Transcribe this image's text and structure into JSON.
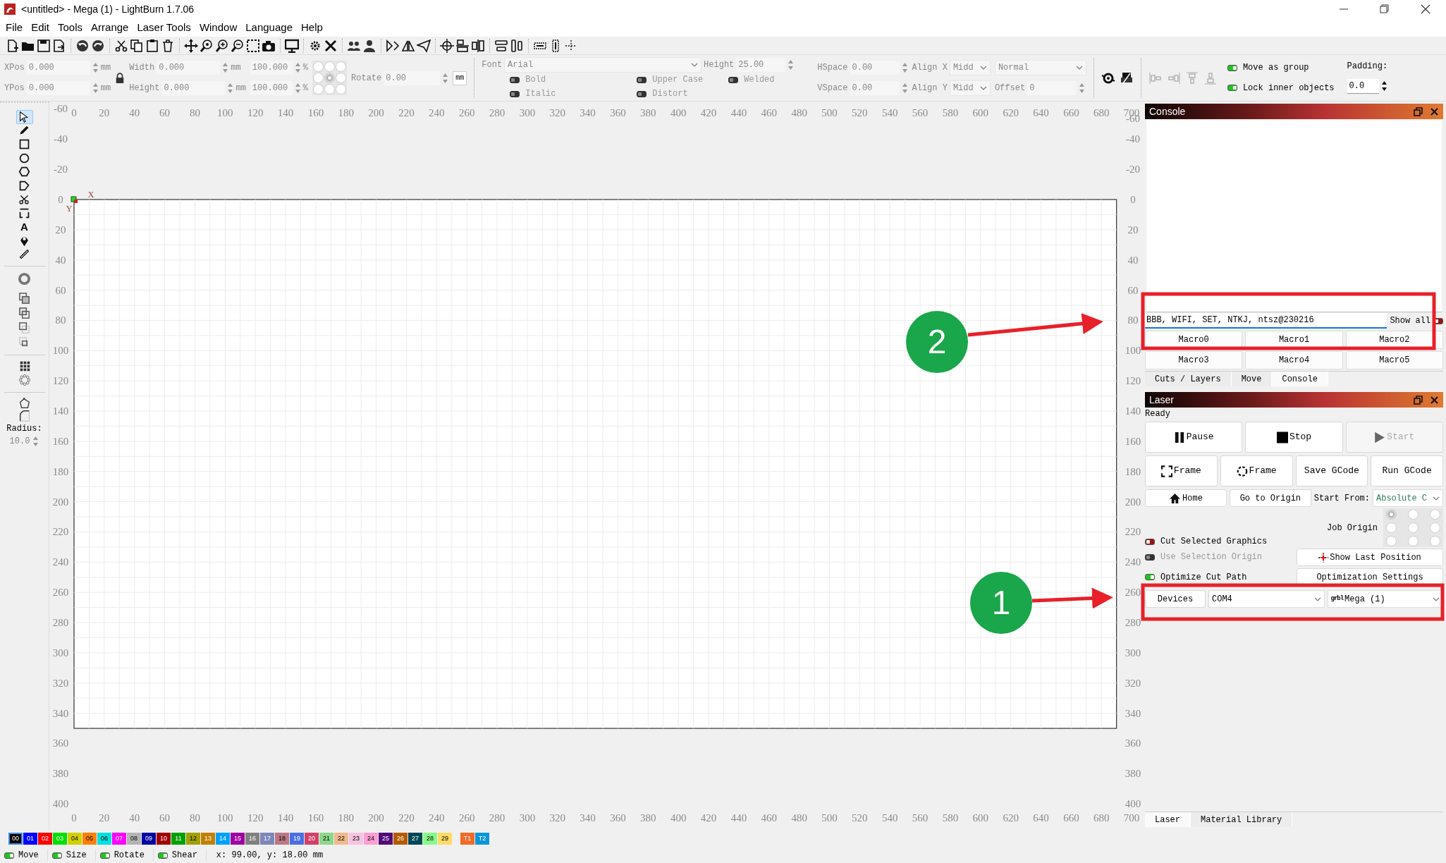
{
  "window": {
    "title": "<untitled> - Mega (1) - LightBurn 1.7.06"
  },
  "menu": [
    "File",
    "Edit",
    "Tools",
    "Arrange",
    "Laser Tools",
    "Window",
    "Language",
    "Help"
  ],
  "properties": {
    "position": [
      {
        "label": "XPos",
        "value": "0.000",
        "unit": "mm"
      },
      {
        "label": "YPos",
        "value": "0.000",
        "unit": "mm"
      }
    ],
    "size": [
      {
        "label": "Width",
        "value": "0.000",
        "unit": "mm"
      },
      {
        "label": "Height",
        "value": "0.000",
        "unit": "mm"
      }
    ],
    "scale": [
      {
        "value": "100.000",
        "unit": "%"
      },
      {
        "value": "100.000",
        "unit": "%"
      }
    ],
    "origin_grid": [
      {
        "selected": false
      },
      {
        "selected": false
      },
      {
        "selected": false
      },
      {
        "selected": false
      },
      {
        "selected": true
      },
      {
        "selected": false
      },
      {
        "selected": false
      },
      {
        "selected": false
      },
      {
        "selected": false
      }
    ],
    "rotate": {
      "label": "Rotate",
      "value": "0.00"
    },
    "unit_button": "mm",
    "font": {
      "label": "Font",
      "value": "Arial"
    },
    "font_height": {
      "label": "Height",
      "value": "25.00"
    },
    "text_toggles": [
      {
        "label": "Bold",
        "on": false,
        "disabled": true
      },
      {
        "label": "Italic",
        "on": false,
        "disabled": true
      },
      {
        "label": "Upper Case",
        "on": false,
        "disabled": true
      },
      {
        "label": "Distort",
        "on": false,
        "disabled": true
      },
      {
        "label": "Welded",
        "on": false,
        "disabled": true
      }
    ],
    "spacing": [
      {
        "label": "HSpace",
        "value": "0.00"
      },
      {
        "label": "VSpace",
        "value": "0.00"
      }
    ],
    "align": [
      {
        "label": "Align X",
        "value": "Midd"
      },
      {
        "label": "Align Y",
        "value": "Midd"
      }
    ],
    "text_mode": {
      "value": "Normal"
    },
    "offset": {
      "label": "Offset",
      "value": "0"
    },
    "group_toggles": [
      {
        "label": "Move as group",
        "on": true
      },
      {
        "label": "Lock inner objects",
        "on": true
      }
    ],
    "padding": {
      "label": "Padding:",
      "value": "0.0"
    }
  },
  "tools": [
    {
      "kind": "pointer",
      "selected": true
    },
    {
      "kind": "pencil",
      "selected": false
    },
    {
      "kind": "rectangle",
      "selected": false
    },
    {
      "kind": "ellipse",
      "selected": false
    },
    {
      "kind": "hexagon",
      "selected": false
    },
    {
      "kind": "pentagon",
      "selected": false
    },
    {
      "kind": "scissors",
      "selected": false
    },
    {
      "kind": "bracket",
      "selected": false
    },
    {
      "kind": "text",
      "glyph": "A",
      "selected": false
    },
    {
      "kind": "pin",
      "selected": false
    },
    {
      "kind": "ruler",
      "selected": false
    }
  ],
  "radius": {
    "label": "Radius:",
    "value": "10.0"
  },
  "canvas": {
    "top_ruler": [
      "0",
      "20",
      "40",
      "60",
      "80",
      "100",
      "120",
      "140",
      "160",
      "180",
      "200",
      "220",
      "240",
      "260",
      "280",
      "300",
      "320",
      "340",
      "360",
      "380",
      "400",
      "420",
      "440",
      "460",
      "480",
      "500",
      "520",
      "540",
      "560",
      "580",
      "600",
      "620",
      "640",
      "660",
      "680",
      "700"
    ],
    "left_ruler": [
      "-60",
      "-40",
      "-20",
      "0",
      "20",
      "40",
      "60",
      "80",
      "100",
      "120",
      "140",
      "160",
      "180",
      "200",
      "220",
      "240",
      "260",
      "280",
      "300",
      "320",
      "340",
      "360",
      "380",
      "400"
    ],
    "right_ruler": [
      "-60",
      "-40",
      "-20",
      "0",
      "20",
      "40",
      "60",
      "80",
      "100",
      "120",
      "140",
      "160",
      "180",
      "200",
      "220",
      "240",
      "260",
      "280",
      "300",
      "320",
      "340",
      "360",
      "380",
      "400"
    ],
    "bottom_ruler": [
      "0",
      "20",
      "40",
      "60",
      "80",
      "100",
      "120",
      "140",
      "160",
      "180",
      "200",
      "220",
      "240",
      "260",
      "280",
      "300",
      "320",
      "340",
      "360",
      "380",
      "400",
      "420",
      "440",
      "460",
      "480",
      "500",
      "520",
      "540",
      "560",
      "580",
      "600",
      "620",
      "640",
      "660",
      "680",
      "700"
    ],
    "axis_labels": [
      "X",
      "Y"
    ]
  },
  "console": {
    "title": "Console",
    "input": "BBB, WIFI, SET, NTKJ, ntsz@230216",
    "show_all": {
      "label": "Show all",
      "on": false
    },
    "macros": [
      "Macro0",
      "Macro1",
      "Macro2",
      "Macro3",
      "Macro4",
      "Macro5"
    ],
    "tabs": [
      {
        "label": "Cuts / Layers",
        "selected": false
      },
      {
        "label": "Move",
        "selected": false
      },
      {
        "label": "Console",
        "selected": true
      }
    ]
  },
  "laser": {
    "title": "Laser",
    "status": "Ready",
    "run_buttons": [
      {
        "kind": "pause",
        "label": "Pause",
        "disabled": false
      },
      {
        "kind": "stop",
        "label": "Stop",
        "disabled": false
      },
      {
        "kind": "start",
        "label": "Start",
        "disabled": true
      }
    ],
    "job_buttons": [
      {
        "kind": "frame-rect",
        "label": "Frame"
      },
      {
        "kind": "frame-circle",
        "label": "Frame"
      },
      {
        "kind": "plain",
        "label": "Save GCode"
      },
      {
        "kind": "plain",
        "label": "Run GCode"
      }
    ],
    "home": "Home",
    "go_to_origin": "Go to Origin",
    "start_from": {
      "label": "Start From:",
      "value": "Absolute C"
    },
    "job_origin": {
      "label": "Job Origin",
      "grid": [
        {
          "selected": true
        },
        {
          "selected": false
        },
        {
          "selected": false
        },
        {
          "selected": false
        },
        {
          "selected": false
        },
        {
          "selected": false
        },
        {
          "selected": false
        },
        {
          "selected": false
        },
        {
          "selected": false
        }
      ]
    },
    "toggles": [
      {
        "label": "Cut Selected Graphics",
        "on": false,
        "disabled": false
      },
      {
        "label": "Use Selection Origin",
        "on": false,
        "disabled": true
      },
      {
        "label": "Optimize Cut Path",
        "on": true,
        "disabled": false
      }
    ],
    "show_last_position": "Show Last Position",
    "optimization_settings": "Optimization Settings",
    "devices": "Devices",
    "port": "COM4",
    "device": {
      "badge": "grbl",
      "name": "Mega (1)"
    }
  },
  "bottom_tabs": [
    {
      "label": "Laser",
      "selected": true
    },
    {
      "label": "Material Library",
      "selected": false
    }
  ],
  "palette": [
    {
      "label": "00",
      "color": "#000000",
      "selected": true
    },
    {
      "label": "01",
      "color": "#0000ff",
      "selected": false
    },
    {
      "label": "02",
      "color": "#ff0000",
      "selected": false
    },
    {
      "label": "03",
      "color": "#00e000",
      "selected": false
    },
    {
      "label": "04",
      "color": "#d0d000",
      "selected": false
    },
    {
      "label": "05",
      "color": "#ff8000",
      "selected": false
    },
    {
      "label": "06",
      "color": "#00e0e0",
      "selected": false
    },
    {
      "label": "07",
      "color": "#ff00ff",
      "selected": false
    },
    {
      "label": "08",
      "color": "#b4b4b4",
      "selected": false
    },
    {
      "label": "09",
      "color": "#0000a0",
      "selected": false
    },
    {
      "label": "10",
      "color": "#a00000",
      "selected": false
    },
    {
      "label": "11",
      "color": "#00a000",
      "selected": false
    },
    {
      "label": "12",
      "color": "#a0a000",
      "selected": false
    },
    {
      "label": "13",
      "color": "#c08000",
      "selected": false
    },
    {
      "label": "14",
      "color": "#00a0ff",
      "selected": false
    },
    {
      "label": "15",
      "color": "#a000a0",
      "selected": false
    },
    {
      "label": "16",
      "color": "#808080",
      "selected": false
    },
    {
      "label": "17",
      "color": "#7d87b9",
      "selected": false
    },
    {
      "label": "18",
      "color": "#bb7784",
      "selected": false
    },
    {
      "label": "19",
      "color": "#4a6fe3",
      "selected": false
    },
    {
      "label": "20",
      "color": "#d33f6a",
      "selected": false
    },
    {
      "label": "21",
      "color": "#8cd78c",
      "selected": false
    },
    {
      "label": "22",
      "color": "#f0b98d",
      "selected": false
    },
    {
      "label": "23",
      "color": "#f6c4e1",
      "selected": false
    },
    {
      "label": "24",
      "color": "#fa9ed4",
      "selected": false
    },
    {
      "label": "25",
      "color": "#500a78",
      "selected": false
    },
    {
      "label": "26",
      "color": "#b45a00",
      "selected": false
    },
    {
      "label": "27",
      "color": "#004754",
      "selected": false
    },
    {
      "label": "28",
      "color": "#86fa88",
      "selected": false
    },
    {
      "label": "29",
      "color": "#ffdb66",
      "selected": false
    },
    {
      "label": "T1",
      "color": "#f36926",
      "selected": false
    },
    {
      "label": "T2",
      "color": "#0c96d9",
      "selected": false
    }
  ],
  "status_toggles": [
    {
      "label": "Move",
      "on": true
    },
    {
      "label": "Size",
      "on": true
    },
    {
      "label": "Rotate",
      "on": true
    },
    {
      "label": "Shear",
      "on": true
    }
  ],
  "coordinates": "x: 99.00, y: 18.00 mm",
  "annotations": [
    {
      "kind": "callout",
      "label": "2"
    },
    {
      "kind": "callout",
      "label": "1"
    }
  ]
}
